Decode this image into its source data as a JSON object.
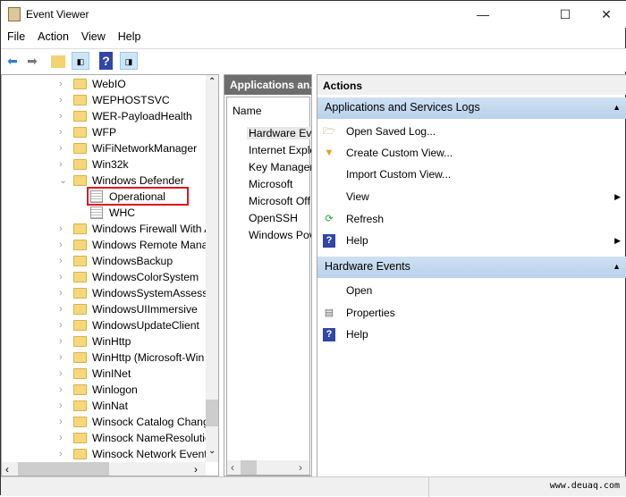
{
  "window": {
    "title": "Event Viewer",
    "minimize": "—",
    "maximize": "☐",
    "close": "✕"
  },
  "menu": [
    "File",
    "Action",
    "View",
    "Help"
  ],
  "tree": {
    "items": [
      {
        "label": "WebIO",
        "expanded": false
      },
      {
        "label": "WEPHOSTSVC",
        "expanded": false
      },
      {
        "label": "WER-PayloadHealth",
        "expanded": false
      },
      {
        "label": "WFP",
        "expanded": false
      },
      {
        "label": "WiFiNetworkManager",
        "expanded": false
      },
      {
        "label": "Win32k",
        "expanded": false
      },
      {
        "label": "Windows Defender",
        "expanded": true
      },
      {
        "label": "Operational",
        "child": true,
        "selected": true
      },
      {
        "label": "WHC",
        "child": true
      },
      {
        "label": "Windows Firewall With A",
        "expanded": false
      },
      {
        "label": "Windows Remote Mana",
        "expanded": false
      },
      {
        "label": "WindowsBackup",
        "expanded": false
      },
      {
        "label": "WindowsColorSystem",
        "expanded": false
      },
      {
        "label": "WindowsSystemAssessn",
        "expanded": false
      },
      {
        "label": "WindowsUIImmersive",
        "expanded": false
      },
      {
        "label": "WindowsUpdateClient",
        "expanded": false
      },
      {
        "label": "WinHttp",
        "expanded": false
      },
      {
        "label": "WinHttp (Microsoft-Win",
        "expanded": false
      },
      {
        "label": "WinINet",
        "expanded": false
      },
      {
        "label": "Winlogon",
        "expanded": false
      },
      {
        "label": "WinNat",
        "expanded": false
      },
      {
        "label": "Winsock Catalog Chang",
        "expanded": false
      },
      {
        "label": "Winsock NameResolutic",
        "expanded": false
      },
      {
        "label": "Winsock Network Event",
        "expanded": false
      }
    ]
  },
  "list": {
    "header": "Applications an...",
    "column": "Name",
    "items": [
      "Hardware Eve",
      "Internet Explc",
      "Key Manager",
      "Microsoft",
      "Microsoft Off",
      "OpenSSH",
      "Windows Pov"
    ]
  },
  "actions": {
    "header": "Actions",
    "sections": [
      {
        "title": "Applications and Services Logs",
        "items": [
          {
            "label": "Open Saved Log...",
            "icon": "folder-open-icon"
          },
          {
            "label": "Create Custom View...",
            "icon": "filter-icon"
          },
          {
            "label": "Import Custom View...",
            "icon": ""
          },
          {
            "label": "View",
            "icon": "",
            "submenu": true
          },
          {
            "label": "Refresh",
            "icon": "refresh-icon"
          },
          {
            "label": "Help",
            "icon": "help-icon",
            "submenu": true
          }
        ]
      },
      {
        "title": "Hardware Events",
        "items": [
          {
            "label": "Open",
            "icon": ""
          },
          {
            "label": "Properties",
            "icon": "properties-icon"
          },
          {
            "label": "Help",
            "icon": "help-icon"
          }
        ]
      }
    ]
  },
  "watermark": "www.deuaq.com",
  "colors": {
    "selection_box": "#e0141e",
    "section_header": "#c4d9ef",
    "list_header": "#6d6d6d"
  }
}
